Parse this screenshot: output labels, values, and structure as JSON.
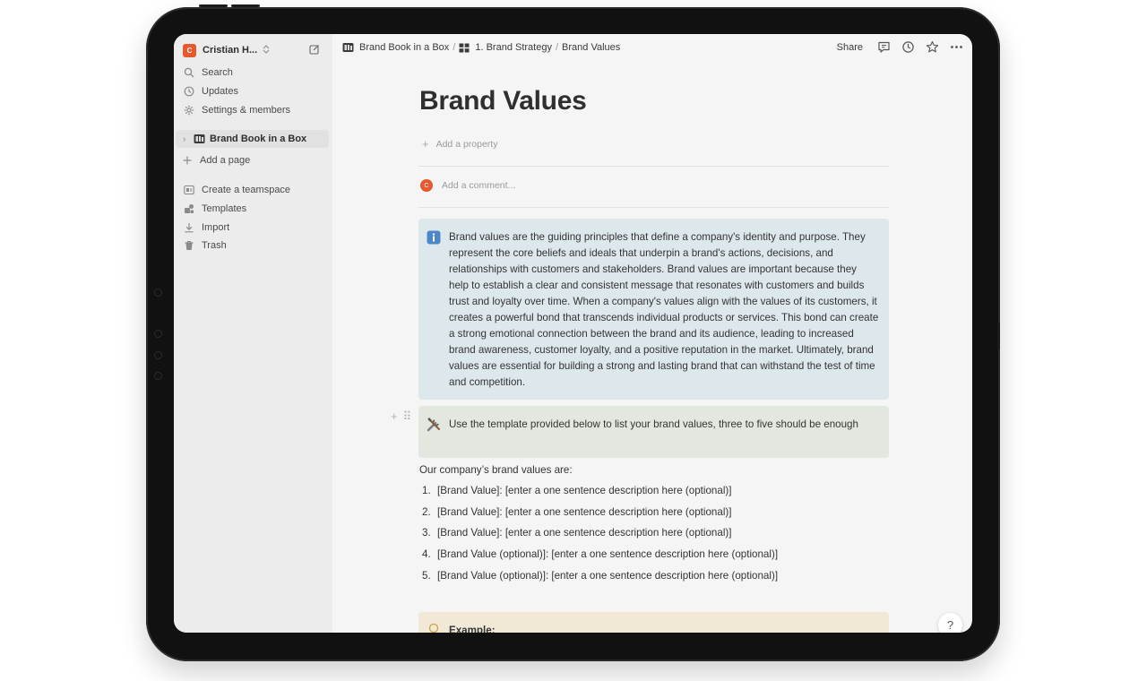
{
  "sidebar": {
    "workspace": {
      "avatar": "C",
      "name": "Cristian H...",
      "caret": "⌃⌄"
    },
    "nav": [
      {
        "label": "Search",
        "icon": "search-icon"
      },
      {
        "label": "Updates",
        "icon": "clock-icon"
      },
      {
        "label": "Settings & members",
        "icon": "gear-icon"
      }
    ],
    "page": {
      "label": "Brand Book in a Box",
      "chevron": "›"
    },
    "add_page": "Add a page",
    "tools": [
      {
        "label": "Create a teamspace",
        "icon": "teamspace-icon"
      },
      {
        "label": "Templates",
        "icon": "templates-icon"
      },
      {
        "label": "Import",
        "icon": "import-icon"
      },
      {
        "label": "Trash",
        "icon": "trash-icon"
      }
    ]
  },
  "topbar": {
    "breadcrumbs": [
      {
        "label": "Brand Book in a Box",
        "icon": "book-icon"
      },
      {
        "label": "1. Brand Strategy",
        "icon": "table-icon"
      },
      {
        "label": "Brand Values"
      }
    ],
    "separator": "/",
    "share_label": "Share"
  },
  "page": {
    "title": "Brand Values",
    "add_property": "Add a property",
    "comment_avatar": "C",
    "comment_placeholder": "Add a comment...",
    "info_callout": "Brand values are the guiding principles that define a company's identity and purpose. They represent the core beliefs and ideals that underpin a brand's actions, decisions, and relationships with customers and stakeholders. Brand values are important because they help to establish a clear and consistent message that resonates with customers and builds trust and loyalty over time. When a company's values align with the values of its customers, it creates a powerful bond that transcends individual products or services. This bond can create a strong emotional connection between the brand and its audience, leading to increased brand awareness, customer loyalty, and a positive reputation in the market. Ultimately, brand values are essential for building a strong and lasting brand that can withstand the test of time and competition.",
    "tool_callout": "Use the template provided below to list your brand values, three to five should be enough",
    "intro": "Our company’s brand values are:",
    "list": [
      {
        "num": "1.",
        "text": "[Brand Value]: [enter a one sentence description here (optional)]"
      },
      {
        "num": "2.",
        "text": "[Brand Value]: [enter a one sentence description here (optional)]"
      },
      {
        "num": "3.",
        "text": "[Brand Value]: [enter a one sentence description here (optional)]"
      },
      {
        "num": "4.",
        "text": "[Brand Value (optional)]: [enter a one sentence description here (optional)]"
      },
      {
        "num": "5.",
        "text": "[Brand Value (optional)]: [enter a one sentence description here (optional)]"
      }
    ],
    "example_callout": "Example:"
  },
  "help_label": "?",
  "colors": {
    "accent": "#e65a2e",
    "info_callout_bg": "#dde8ec",
    "tool_callout_bg": "#e2e8e0",
    "example_callout_bg": "#f1e9d6"
  }
}
